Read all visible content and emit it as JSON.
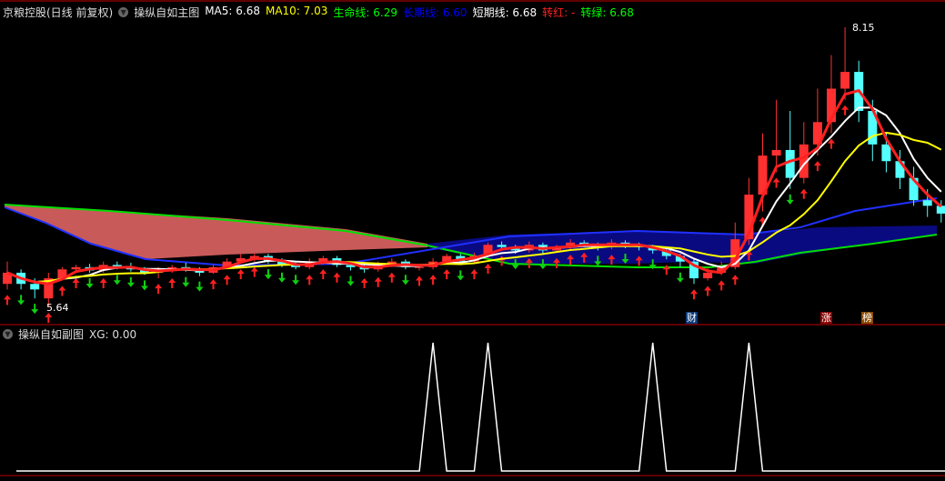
{
  "header": {
    "stock": "京粮控股(日线 前复权)",
    "indicator": "操纵自如主图",
    "items": [
      {
        "label": "MA5: 6.68",
        "color": "#ffffff"
      },
      {
        "label": "MA10: 7.03",
        "color": "#ffff00"
      },
      {
        "label": "生命线: 6.29",
        "color": "#00ff00"
      },
      {
        "label": "长期线: 6.60",
        "color": "#0000ff"
      },
      {
        "label": "短期线: 6.68",
        "color": "#ffffff"
      },
      {
        "label": "转红: -",
        "color": "#ff2020"
      },
      {
        "label": "转绿: 6.68",
        "color": "#00ff00"
      }
    ]
  },
  "sub": {
    "indicator": "操纵自如副图",
    "value": "XG: 0.00"
  },
  "markers": {
    "high": "8.15",
    "low": "5.64",
    "cai": "财",
    "zhang": "涨",
    "bang": "榜"
  },
  "colors": {
    "up": "#ff3030",
    "down": "#54ffff",
    "divider": "#c00000"
  },
  "chart_data": {
    "type": "candlestick",
    "price_range": [
      5.55,
      8.3
    ],
    "high": 8.15,
    "low": 5.64,
    "ohlc": [
      [
        5.85,
        5.95,
        6.05,
        5.8
      ],
      [
        5.95,
        5.85,
        5.98,
        5.8
      ],
      [
        5.85,
        5.8,
        5.9,
        5.72
      ],
      [
        5.72,
        5.9,
        5.95,
        5.64
      ],
      [
        5.9,
        5.98,
        6.0,
        5.88
      ],
      [
        5.98,
        6.0,
        6.02,
        5.95
      ],
      [
        6.0,
        5.97,
        6.03,
        5.95
      ],
      [
        5.97,
        6.02,
        6.05,
        5.95
      ],
      [
        6.02,
        6.0,
        6.05,
        5.98
      ],
      [
        6.0,
        5.98,
        6.04,
        5.96
      ],
      [
        5.98,
        5.95,
        6.0,
        5.93
      ],
      [
        5.95,
        5.97,
        6.0,
        5.9
      ],
      [
        5.97,
        6.0,
        6.02,
        5.95
      ],
      [
        6.0,
        5.98,
        6.04,
        5.96
      ],
      [
        5.98,
        5.95,
        6.0,
        5.92
      ],
      [
        5.95,
        6.0,
        6.02,
        5.94
      ],
      [
        6.0,
        6.05,
        6.08,
        5.98
      ],
      [
        6.05,
        6.08,
        6.12,
        6.03
      ],
      [
        6.08,
        6.1,
        6.13,
        6.05
      ],
      [
        6.1,
        6.05,
        6.12,
        6.03
      ],
      [
        6.05,
        6.02,
        6.08,
        6.0
      ],
      [
        6.02,
        6.0,
        6.05,
        5.98
      ],
      [
        6.0,
        6.05,
        6.08,
        5.98
      ],
      [
        6.05,
        6.08,
        6.1,
        6.03
      ],
      [
        6.08,
        6.02,
        6.1,
        6.0
      ],
      [
        6.02,
        6.0,
        6.05,
        5.97
      ],
      [
        6.0,
        5.98,
        6.03,
        5.95
      ],
      [
        5.98,
        6.02,
        6.05,
        5.96
      ],
      [
        6.02,
        6.05,
        6.08,
        6.0
      ],
      [
        6.05,
        6.0,
        6.07,
        5.98
      ],
      [
        6.0,
        6.0,
        6.03,
        5.97
      ],
      [
        6.0,
        6.05,
        6.08,
        5.98
      ],
      [
        6.05,
        6.1,
        6.12,
        6.03
      ],
      [
        6.1,
        6.05,
        6.12,
        6.02
      ],
      [
        6.05,
        6.1,
        6.13,
        6.03
      ],
      [
        6.1,
        6.2,
        6.22,
        6.08
      ],
      [
        6.2,
        6.18,
        6.23,
        6.15
      ],
      [
        6.18,
        6.15,
        6.2,
        6.12
      ],
      [
        6.15,
        6.2,
        6.23,
        6.13
      ],
      [
        6.2,
        6.15,
        6.22,
        6.12
      ],
      [
        6.15,
        6.18,
        6.2,
        6.13
      ],
      [
        6.18,
        6.22,
        6.25,
        6.16
      ],
      [
        6.22,
        6.2,
        6.24,
        6.18
      ],
      [
        6.2,
        6.18,
        6.22,
        6.15
      ],
      [
        6.18,
        6.22,
        6.25,
        6.16
      ],
      [
        6.22,
        6.2,
        6.24,
        6.17
      ],
      [
        6.2,
        6.18,
        6.22,
        6.15
      ],
      [
        6.18,
        6.15,
        6.2,
        6.12
      ],
      [
        6.15,
        6.1,
        6.17,
        6.07
      ],
      [
        6.1,
        6.05,
        6.12,
        6.0
      ],
      [
        6.05,
        5.9,
        6.07,
        5.85
      ],
      [
        5.9,
        5.95,
        6.0,
        5.88
      ],
      [
        5.95,
        6.0,
        6.05,
        5.93
      ],
      [
        6.0,
        6.25,
        6.4,
        5.98
      ],
      [
        6.25,
        6.65,
        6.8,
        6.2
      ],
      [
        6.65,
        7.0,
        7.2,
        6.5
      ],
      [
        7.0,
        7.05,
        7.5,
        6.85
      ],
      [
        7.05,
        6.8,
        7.4,
        6.7
      ],
      [
        6.8,
        7.1,
        7.3,
        6.75
      ],
      [
        7.1,
        7.3,
        7.6,
        7.0
      ],
      [
        7.3,
        7.6,
        7.9,
        7.2
      ],
      [
        7.6,
        7.75,
        8.15,
        7.5
      ],
      [
        7.75,
        7.4,
        7.85,
        7.3
      ],
      [
        7.4,
        7.1,
        7.5,
        6.95
      ],
      [
        7.1,
        6.95,
        7.2,
        6.85
      ],
      [
        6.95,
        6.8,
        7.05,
        6.7
      ],
      [
        6.8,
        6.6,
        6.9,
        6.55
      ],
      [
        6.6,
        6.55,
        6.7,
        6.45
      ],
      [
        6.55,
        6.48,
        6.6,
        6.4
      ]
    ],
    "xg_signal_indices": [
      31,
      35,
      47,
      54
    ],
    "sub_range": [
      0,
      1
    ]
  }
}
